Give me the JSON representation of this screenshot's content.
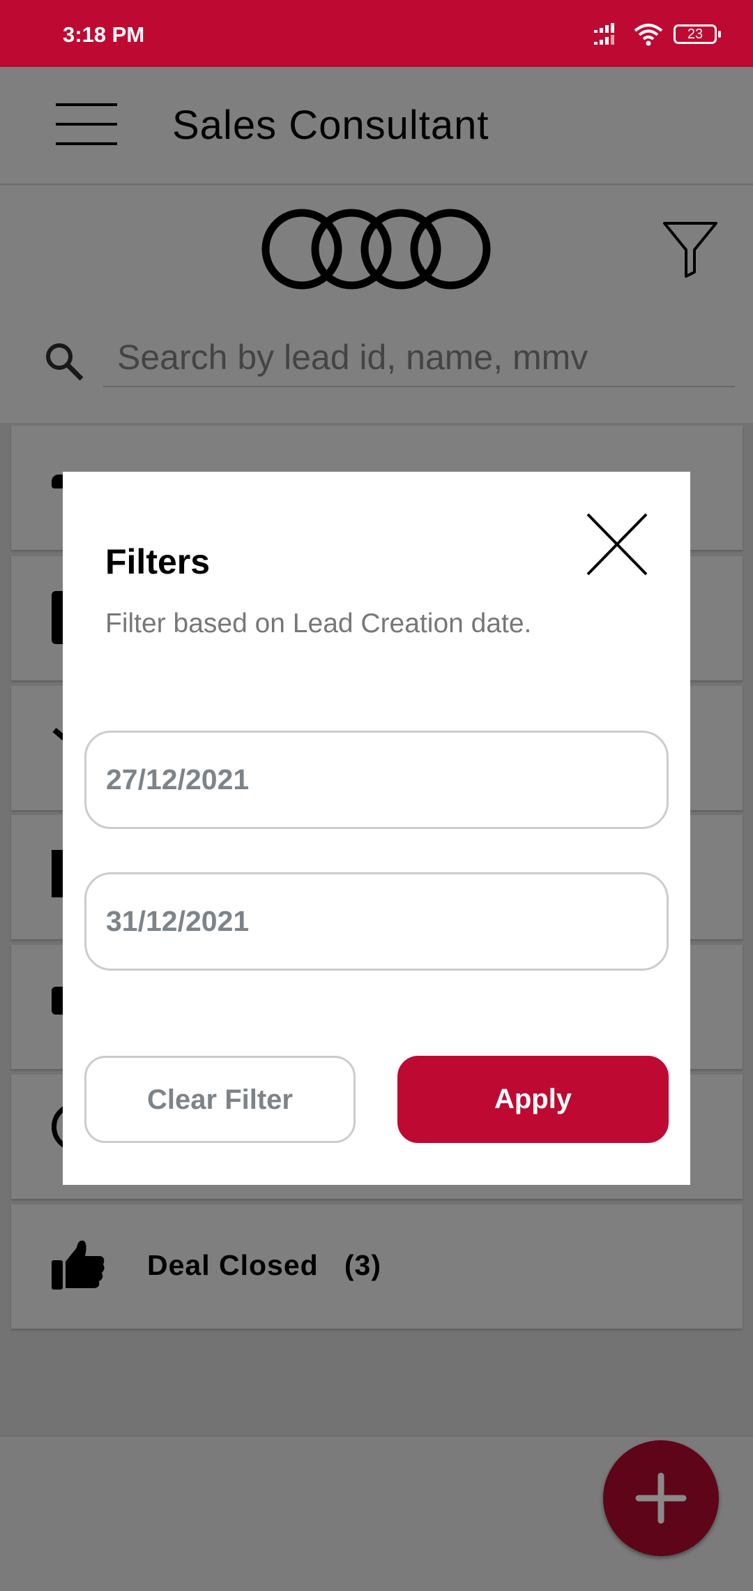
{
  "status_bar": {
    "time": "3:18 PM",
    "battery": "23",
    "icons": [
      "signal-icon",
      "wifi-icon",
      "battery-icon"
    ]
  },
  "app_bar": {
    "title": "Sales Consultant",
    "menu_icon": "hamburger-icon"
  },
  "header": {
    "logo": "audi-rings-logo",
    "filter_icon": "funnel-icon"
  },
  "search": {
    "placeholder": "Search by lead id, name, mmv",
    "value": ""
  },
  "list": {
    "items": [
      {
        "label": "Deal Closed   (3)",
        "icon": "thumbs-up-icon"
      }
    ]
  },
  "fab": {
    "icon": "plus-icon"
  },
  "filter_dialog": {
    "title": "Filters",
    "subtitle": "Filter based on Lead Creation date.",
    "from_date": "27/12/2021",
    "to_date": "31/12/2021",
    "clear_label": "Clear Filter",
    "apply_label": "Apply"
  },
  "colors": {
    "brand": "#be0a32",
    "overlay": "rgba(0,0,0,0.5)"
  }
}
